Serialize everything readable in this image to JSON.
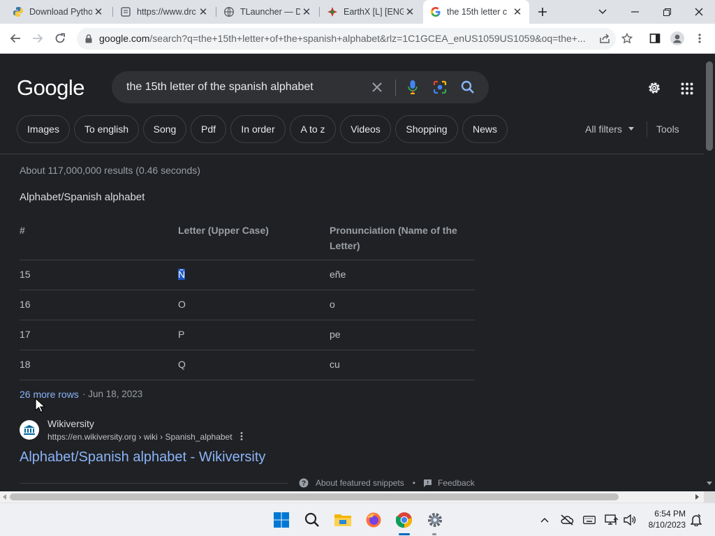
{
  "tabs": [
    {
      "title": "Download Pytho",
      "icon": "python-icon"
    },
    {
      "title": "https://www.drc",
      "icon": "page-icon"
    },
    {
      "title": "TLauncher — D",
      "icon": "globe-icon"
    },
    {
      "title": "EarthX [L] [ENG",
      "icon": "earthx-icon"
    },
    {
      "title": "the 15th letter c",
      "icon": "google-icon"
    }
  ],
  "address_bar": {
    "url_host": "google.com",
    "url_rest": "/search?q=the+15th+letter+of+the+spanish+alphabet&rlz=1C1GCEA_enUS1059US1059&oq=the+..."
  },
  "google": {
    "logo": "Google",
    "query": "the 15th letter of the spanish alphabet",
    "chips": [
      "Images",
      "To english",
      "Song",
      "Pdf",
      "In order",
      "A to z",
      "Videos",
      "Shopping",
      "News"
    ],
    "all_filters": "All filters",
    "tools": "Tools",
    "result_stats": "About 117,000,000 results (0.46 seconds)",
    "snippet_title": "Alphabet/Spanish alphabet",
    "table": {
      "headers": [
        "#",
        "Letter (Upper Case)",
        "Pronunciation (Name of the Letter)"
      ],
      "rows": [
        [
          "15",
          "Ñ",
          "eñe"
        ],
        [
          "16",
          "O",
          "o"
        ],
        [
          "17",
          "P",
          "pe"
        ],
        [
          "18",
          "Q",
          "cu"
        ]
      ]
    },
    "more_rows": "26 more rows",
    "date": "· Jun 18, 2023",
    "result": {
      "site_name": "Wikiversity",
      "site_url": "https://en.wikiversity.org › wiki › Spanish_alphabet",
      "title": "Alphabet/Spanish alphabet - Wikiversity"
    },
    "about_snippets": "About featured snippets",
    "feedback": "Feedback",
    "separator_dot": "•"
  },
  "taskbar": {
    "time": "6:54 PM",
    "date": "8/10/2023"
  },
  "colors": {
    "page_bg": "#202124",
    "link": "#8ab4f8",
    "selection": "#1a56c4"
  }
}
